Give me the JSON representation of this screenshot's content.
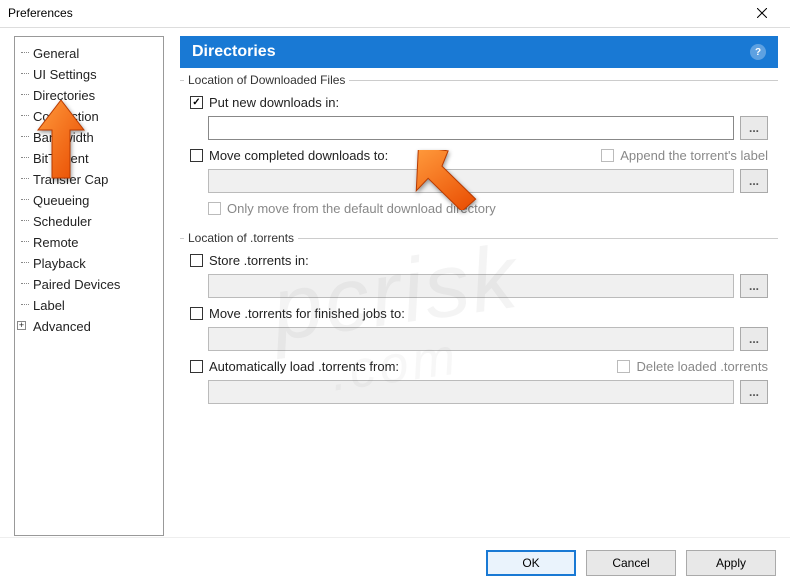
{
  "window": {
    "title": "Preferences"
  },
  "sidebar": {
    "items": [
      {
        "label": "General"
      },
      {
        "label": "UI Settings"
      },
      {
        "label": "Directories"
      },
      {
        "label": "Connection"
      },
      {
        "label": "Bandwidth"
      },
      {
        "label": "BitTorrent"
      },
      {
        "label": "Transfer Cap"
      },
      {
        "label": "Queueing"
      },
      {
        "label": "Scheduler"
      },
      {
        "label": "Remote"
      },
      {
        "label": "Playback"
      },
      {
        "label": "Paired Devices"
      },
      {
        "label": "Label"
      },
      {
        "label": "Advanced"
      }
    ]
  },
  "panel": {
    "title": "Directories",
    "group1": {
      "title": "Location of Downloaded Files",
      "put_new_label": "Put new downloads in:",
      "put_new_checked": true,
      "put_new_path": "",
      "move_completed_label": "Move completed downloads to:",
      "move_completed_checked": false,
      "append_label_label": "Append the torrent's label",
      "move_completed_path": "",
      "only_move_label": "Only move from the default download directory"
    },
    "group2": {
      "title": "Location of .torrents",
      "store_label": "Store .torrents in:",
      "store_checked": false,
      "store_path": "",
      "move_finished_label": "Move .torrents for finished jobs to:",
      "move_finished_checked": false,
      "move_finished_path": "",
      "autoload_label": "Automatically load .torrents from:",
      "autoload_checked": false,
      "delete_loaded_label": "Delete loaded .torrents",
      "autoload_path": ""
    }
  },
  "buttons": {
    "ok": "OK",
    "cancel": "Cancel",
    "apply": "Apply",
    "browse": "..."
  },
  "watermark": {
    "main": "pcrisk",
    "sub": ".com"
  }
}
